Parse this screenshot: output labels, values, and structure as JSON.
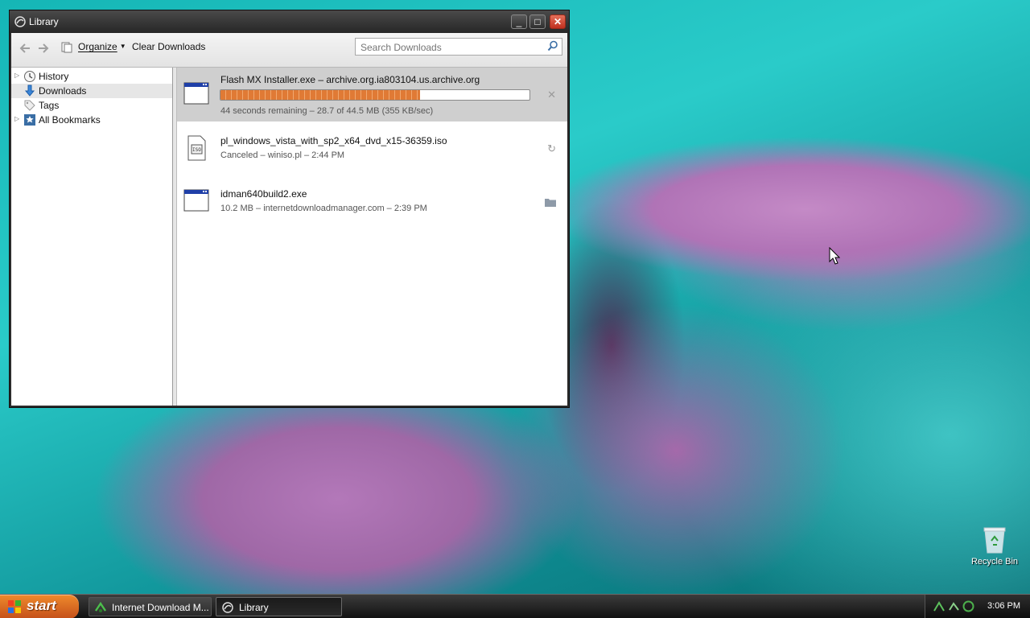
{
  "window": {
    "title": "Library",
    "controls": {
      "minimize": "_",
      "maximize": "□",
      "close": "✕"
    }
  },
  "toolbar": {
    "organize_label": "Organize",
    "clear_label": "Clear Downloads",
    "search_placeholder": "Search Downloads"
  },
  "sidebar": {
    "items": [
      {
        "label": "History",
        "icon": "clock-icon",
        "expandable": true
      },
      {
        "label": "Downloads",
        "icon": "download-arrow-icon",
        "expandable": false,
        "selected": true
      },
      {
        "label": "Tags",
        "icon": "tag-icon",
        "expandable": false
      },
      {
        "label": "All Bookmarks",
        "icon": "star-icon",
        "expandable": true
      }
    ]
  },
  "downloads": [
    {
      "name": "Flash MX Installer.exe – archive.org.ia803104.us.archive.org",
      "status": "44 seconds remaining – 28.7 of 44.5 MB (355 KB/sec)",
      "progress": 0.645,
      "action": "cancel-icon",
      "action_glyph": "✕"
    },
    {
      "name": "pl_windows_vista_with_sp2_x64_dvd_x15-36359.iso",
      "status": "Canceled – winiso.pl – 2:44 PM",
      "action": "retry-icon",
      "action_glyph": "↻"
    },
    {
      "name": "idman640build2.exe",
      "status": "10.2 MB – internetdownloadmanager.com – 2:39 PM",
      "action": "folder-icon"
    }
  ],
  "desktop": {
    "recycle_bin_label": "Recycle Bin"
  },
  "taskbar": {
    "start_label": "start",
    "tasks": [
      {
        "label": "Internet Download M...",
        "active": false
      },
      {
        "label": "Library",
        "active": true
      }
    ],
    "clock": "3:06 PM"
  },
  "colors": {
    "progress": "#e07a35",
    "start_button": "#e06f22",
    "taskbar": "#1f1f1f"
  }
}
